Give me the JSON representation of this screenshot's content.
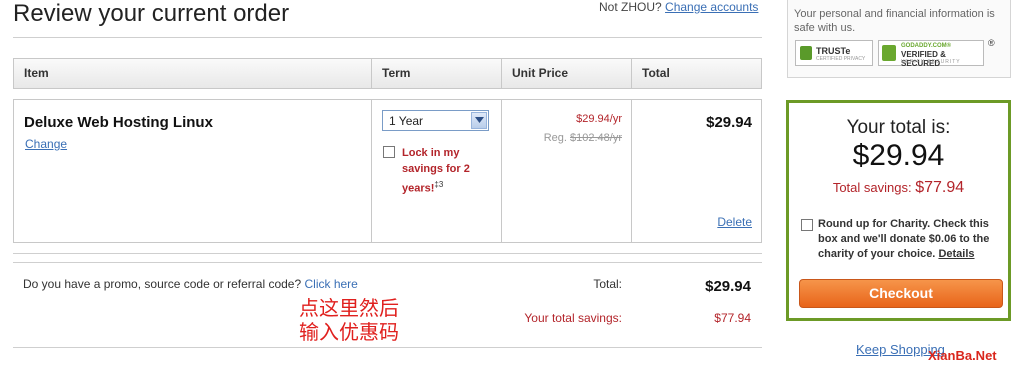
{
  "header": {
    "title": "Review your current order",
    "account_prefix": "Not ZHOU?",
    "change_accounts": "Change accounts"
  },
  "table": {
    "columns": [
      "Item",
      "Term",
      "Unit Price",
      "Total"
    ]
  },
  "item": {
    "name": "Deluxe Web Hosting Linux",
    "change_label": "Change",
    "term_selected": "1 Year",
    "lock_label": "Lock in my savings for 2 years!",
    "lock_footnote": "‡3",
    "unit_price": "$29.94/yr",
    "reg_prefix": "Reg.",
    "reg_price": "$102.48/yr",
    "total": "$29.94",
    "delete_label": "Delete"
  },
  "summary": {
    "promo_question": "Do you have a promo, source code or referral code?",
    "promo_link": "Click here",
    "total_label": "Total:",
    "total_value": "$29.94",
    "savings_label": "Your total savings:",
    "savings_value": "$77.94"
  },
  "annotation": {
    "line1": "点这里然后",
    "line2": "输入优惠码"
  },
  "security": {
    "text": "Your personal and financial information is safe with us.",
    "truste": "TRUSTe",
    "truste_sub": "CERTIFIED PRIVACY",
    "godaddy_top": "GODADDY.COM®",
    "godaddy_main": "VERIFIED & SECURED",
    "godaddy_sub": "VERIFY SECURITY",
    "reg_mark": "®"
  },
  "panel": {
    "your_total_label": "Your total is:",
    "your_total_value": "$29.94",
    "savings_label": "Total savings:",
    "savings_value": "$77.94",
    "charity_text": "Round up for Charity. Check this box and we'll donate $0.06 to the charity of your choice.",
    "charity_details": "Details",
    "checkout_label": "Checkout"
  },
  "footer": {
    "keep_shopping": "Keep Shopping",
    "watermark": "XianBa.Net"
  },
  "colors": {
    "accent_red": "#b3242a",
    "link_blue": "#3a6fb5",
    "panel_green": "#6c9a26",
    "checkout_orange": "#e8641a"
  }
}
